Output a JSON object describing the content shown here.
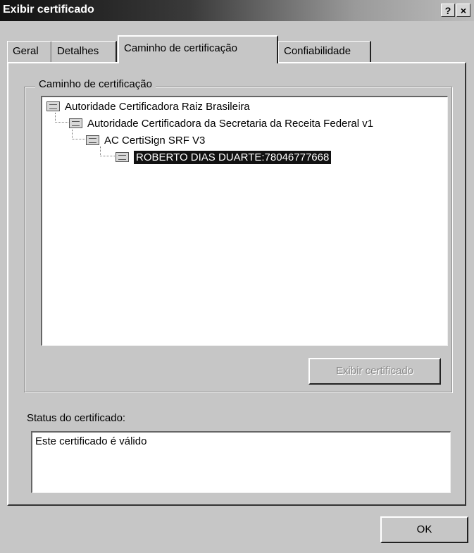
{
  "window": {
    "title": "Exibir certificado",
    "help_label": "?",
    "close_label": "×"
  },
  "tabs": [
    {
      "label": "Geral",
      "active": false
    },
    {
      "label": "Detalhes",
      "active": false
    },
    {
      "label": "Caminho de certificação",
      "active": true
    },
    {
      "label": "Confiabilidade",
      "active": false
    }
  ],
  "certification_path": {
    "group_label": "Caminho de certificação",
    "nodes": [
      {
        "label": "Autoridade Certificadora Raiz Brasileira",
        "icon": "certificate-icon",
        "level": 0
      },
      {
        "label": "Autoridade Certificadora da Secretaria da Receita Federal v1",
        "icon": "certificate-icon",
        "level": 1
      },
      {
        "label": "AC CertiSign SRF V3",
        "icon": "certificate-icon",
        "level": 2
      },
      {
        "label": "ROBERTO DIAS DUARTE:78046777668",
        "icon": "certificate-icon",
        "level": 3,
        "selected": true
      }
    ],
    "view_button_label": "Exibir certificado",
    "view_button_enabled": false
  },
  "status": {
    "label": "Status do certificado:",
    "text": "Este certificado é válido"
  },
  "ok_label": "OK"
}
